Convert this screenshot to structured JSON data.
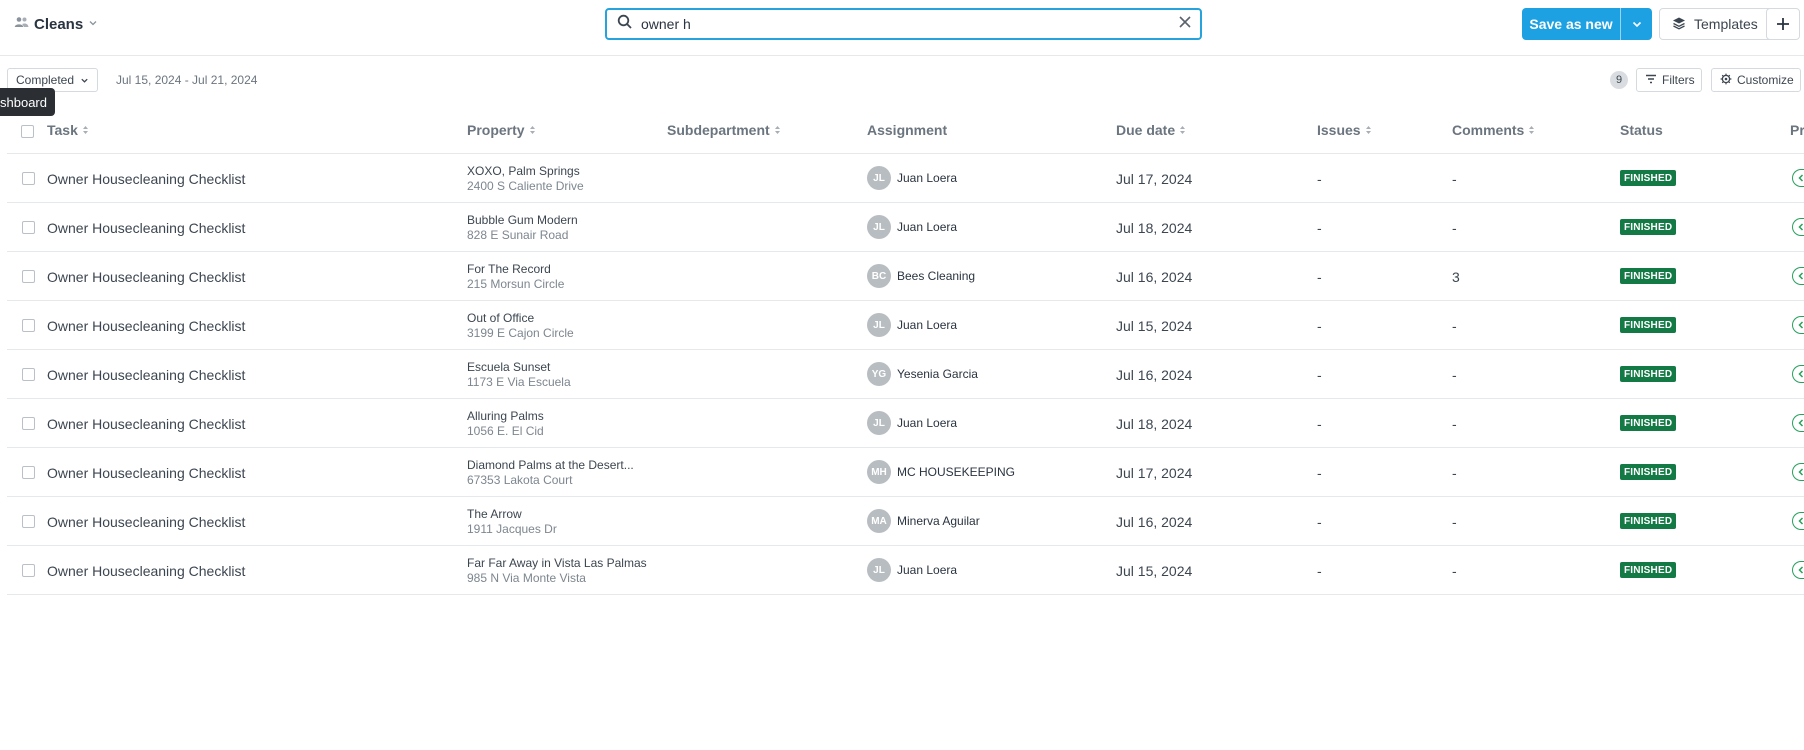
{
  "header": {
    "title": "Cleans",
    "search_value": "owner h",
    "save_label": "Save as new",
    "templates_label": "Templates"
  },
  "toolbar": {
    "filter_status": "Completed",
    "date_range": "Jul 15, 2024 - Jul 21, 2024",
    "tooltip": "shboard",
    "count": "9",
    "filters_label": "Filters",
    "customize_label": "Customize"
  },
  "table": {
    "columns": {
      "task": "Task",
      "property": "Property",
      "subdepartment": "Subdepartment",
      "assignment": "Assignment",
      "due_date": "Due date",
      "issues": "Issues",
      "comments": "Comments",
      "status": "Status",
      "pr": "Pr"
    },
    "rows": [
      {
        "task": "Owner Housecleaning Checklist",
        "property": "XOXO, Palm Springs",
        "address": "2400 S Caliente Drive",
        "initials": "JL",
        "assignee": "Juan Loera",
        "due": "Jul 17, 2024",
        "issues": "-",
        "comments": "-",
        "status": "FINISHED"
      },
      {
        "task": "Owner Housecleaning Checklist",
        "property": "Bubble Gum Modern",
        "address": "828 E Sunair Road",
        "initials": "JL",
        "assignee": "Juan Loera",
        "due": "Jul 18, 2024",
        "issues": "-",
        "comments": "-",
        "status": "FINISHED"
      },
      {
        "task": "Owner Housecleaning Checklist",
        "property": "For The Record",
        "address": "215 Morsun Circle",
        "initials": "BC",
        "assignee": "Bees Cleaning",
        "due": "Jul 16, 2024",
        "issues": "-",
        "comments": "3",
        "status": "FINISHED"
      },
      {
        "task": "Owner Housecleaning Checklist",
        "property": "Out of Office",
        "address": "3199 E Cajon Circle",
        "initials": "JL",
        "assignee": "Juan Loera",
        "due": "Jul 15, 2024",
        "issues": "-",
        "comments": "-",
        "status": "FINISHED"
      },
      {
        "task": "Owner Housecleaning Checklist",
        "property": "Escuela Sunset",
        "address": "1173 E Via Escuela",
        "initials": "YG",
        "assignee": "Yesenia Garcia",
        "due": "Jul 16, 2024",
        "issues": "-",
        "comments": "-",
        "status": "FINISHED"
      },
      {
        "task": "Owner Housecleaning Checklist",
        "property": "Alluring Palms",
        "address": "1056 E. El Cid",
        "initials": "JL",
        "assignee": "Juan Loera",
        "due": "Jul 18, 2024",
        "issues": "-",
        "comments": "-",
        "status": "FINISHED"
      },
      {
        "task": "Owner Housecleaning Checklist",
        "property": "Diamond Palms at the Desert...",
        "address": "67353 Lakota Court",
        "initials": "MH",
        "assignee": "MC HOUSEKEEPING",
        "due": "Jul 17, 2024",
        "issues": "-",
        "comments": "-",
        "status": "FINISHED"
      },
      {
        "task": "Owner Housecleaning Checklist",
        "property": "The Arrow",
        "address": "1911 Jacques Dr",
        "initials": "MA",
        "assignee": "Minerva Aguilar",
        "due": "Jul 16, 2024",
        "issues": "-",
        "comments": "-",
        "status": "FINISHED"
      },
      {
        "task": "Owner Housecleaning Checklist",
        "property": "Far Far Away in Vista Las Palmas",
        "address": "985 N Via Monte Vista",
        "initials": "JL",
        "assignee": "Juan Loera",
        "due": "Jul 15, 2024",
        "issues": "-",
        "comments": "-",
        "status": "FINISHED"
      }
    ]
  }
}
